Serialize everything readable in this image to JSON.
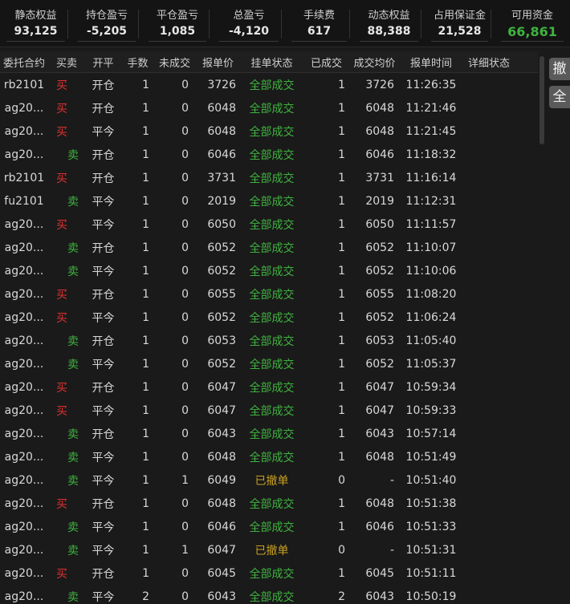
{
  "summary": [
    {
      "label": "静态权益",
      "value": "93,125"
    },
    {
      "label": "持仓盈亏",
      "value": "-5,205"
    },
    {
      "label": "平仓盈亏",
      "value": "1,085"
    },
    {
      "label": "总盈亏",
      "value": "-4,120"
    },
    {
      "label": "手续费",
      "value": "617"
    },
    {
      "label": "动态权益",
      "value": "88,388"
    },
    {
      "label": "占用保证金",
      "value": "21,528"
    },
    {
      "label": "可用资金",
      "value": "66,861"
    }
  ],
  "table": {
    "headers": [
      "委托合约",
      "买卖",
      "开平",
      "手数",
      "未成交",
      "报单价",
      "挂单状态",
      "已成交",
      "成交均价",
      "报单时间",
      "详细状态"
    ],
    "rows": [
      [
        "rb2101",
        "买",
        "开仓",
        "1",
        "0",
        "3726",
        "全部成交",
        "1",
        "3726",
        "11:26:35",
        ""
      ],
      [
        "ag20...",
        "买",
        "开仓",
        "1",
        "0",
        "6048",
        "全部成交",
        "1",
        "6048",
        "11:21:46",
        ""
      ],
      [
        "ag20...",
        "买",
        "平今",
        "1",
        "0",
        "6048",
        "全部成交",
        "1",
        "6048",
        "11:21:45",
        ""
      ],
      [
        "ag20...",
        "卖",
        "开仓",
        "1",
        "0",
        "6046",
        "全部成交",
        "1",
        "6046",
        "11:18:32",
        ""
      ],
      [
        "rb2101",
        "买",
        "开仓",
        "1",
        "0",
        "3731",
        "全部成交",
        "1",
        "3731",
        "11:16:14",
        ""
      ],
      [
        "fu2101",
        "卖",
        "平今",
        "1",
        "0",
        "2019",
        "全部成交",
        "1",
        "2019",
        "11:12:31",
        ""
      ],
      [
        "ag20...",
        "买",
        "平今",
        "1",
        "0",
        "6050",
        "全部成交",
        "1",
        "6050",
        "11:11:57",
        ""
      ],
      [
        "ag20...",
        "卖",
        "开仓",
        "1",
        "0",
        "6052",
        "全部成交",
        "1",
        "6052",
        "11:10:07",
        ""
      ],
      [
        "ag20...",
        "卖",
        "平今",
        "1",
        "0",
        "6052",
        "全部成交",
        "1",
        "6052",
        "11:10:06",
        ""
      ],
      [
        "ag20...",
        "买",
        "开仓",
        "1",
        "0",
        "6055",
        "全部成交",
        "1",
        "6055",
        "11:08:20",
        ""
      ],
      [
        "ag20...",
        "买",
        "平今",
        "1",
        "0",
        "6052",
        "全部成交",
        "1",
        "6052",
        "11:06:24",
        ""
      ],
      [
        "ag20...",
        "卖",
        "开仓",
        "1",
        "0",
        "6053",
        "全部成交",
        "1",
        "6053",
        "11:05:40",
        ""
      ],
      [
        "ag20...",
        "卖",
        "平今",
        "1",
        "0",
        "6052",
        "全部成交",
        "1",
        "6052",
        "11:05:37",
        ""
      ],
      [
        "ag20...",
        "买",
        "开仓",
        "1",
        "0",
        "6047",
        "全部成交",
        "1",
        "6047",
        "10:59:34",
        ""
      ],
      [
        "ag20...",
        "买",
        "平今",
        "1",
        "0",
        "6047",
        "全部成交",
        "1",
        "6047",
        "10:59:33",
        ""
      ],
      [
        "ag20...",
        "卖",
        "开仓",
        "1",
        "0",
        "6043",
        "全部成交",
        "1",
        "6043",
        "10:57:14",
        ""
      ],
      [
        "ag20...",
        "卖",
        "平今",
        "1",
        "0",
        "6048",
        "全部成交",
        "1",
        "6048",
        "10:51:49",
        ""
      ],
      [
        "ag20...",
        "卖",
        "平今",
        "1",
        "1",
        "6049",
        "已撤单",
        "0",
        "-",
        "10:51:40",
        ""
      ],
      [
        "ag20...",
        "买",
        "开仓",
        "1",
        "0",
        "6048",
        "全部成交",
        "1",
        "6048",
        "10:51:38",
        ""
      ],
      [
        "ag20...",
        "卖",
        "平今",
        "1",
        "0",
        "6046",
        "全部成交",
        "1",
        "6046",
        "10:51:33",
        ""
      ],
      [
        "ag20...",
        "卖",
        "平今",
        "1",
        "1",
        "6047",
        "已撤单",
        "0",
        "-",
        "10:51:31",
        ""
      ],
      [
        "ag20...",
        "买",
        "开仓",
        "1",
        "0",
        "6045",
        "全部成交",
        "1",
        "6045",
        "10:51:11",
        ""
      ],
      [
        "ag20...",
        "卖",
        "平今",
        "2",
        "0",
        "6043",
        "全部成交",
        "2",
        "6043",
        "10:50:19",
        ""
      ]
    ]
  },
  "side_buttons": {
    "cancel": "撤",
    "all": "全"
  },
  "colors": {
    "buy": "#e03030",
    "sell": "#3fb33f",
    "filled": "#3fb33f",
    "cancelled": "#c8a020",
    "available": "#3fb33f"
  }
}
